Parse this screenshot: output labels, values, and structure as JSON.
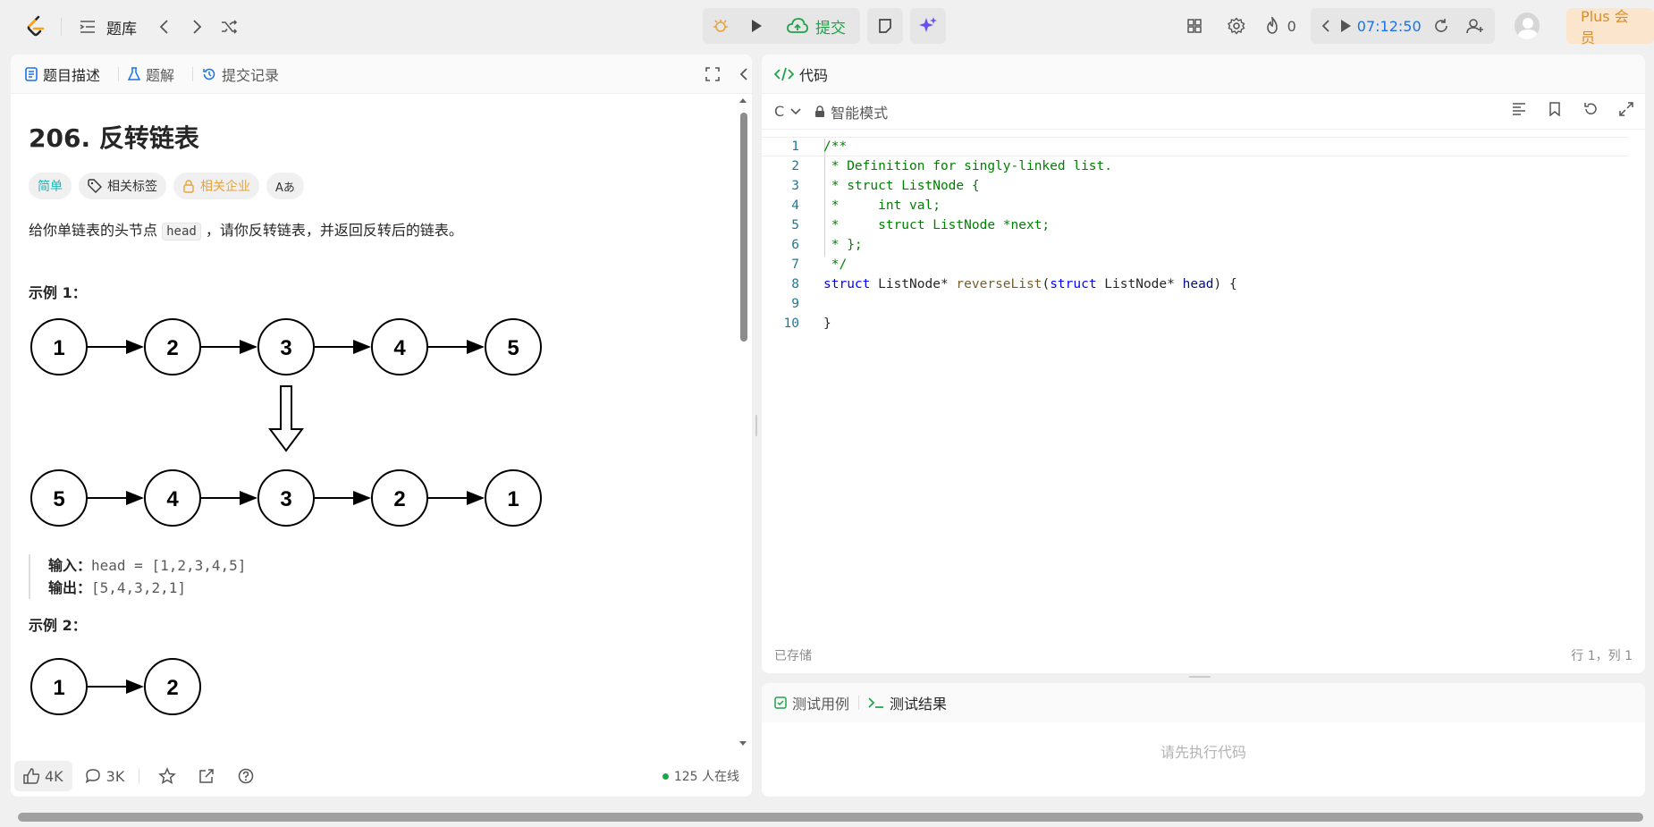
{
  "topbar": {
    "problem_list": "题库",
    "submit": "提交",
    "streak": "0",
    "timer": "07:12:50",
    "plus": "Plus 会员"
  },
  "left": {
    "tabs": [
      {
        "label": "题目描述"
      },
      {
        "label": "题解"
      },
      {
        "label": "提交记录"
      }
    ],
    "title": "206. 反转链表",
    "tags": {
      "difficulty": "简单",
      "topics": "相关标签",
      "companies": "相关企业",
      "translate": "Aあ"
    },
    "description_before": "给你单链表的头节点 ",
    "description_code": "head",
    "description_after": " ，请你反转链表，并返回反转后的链表。",
    "example1": {
      "title": "示例 1：",
      "top_nodes": [
        "1",
        "2",
        "3",
        "4",
        "5"
      ],
      "bottom_nodes": [
        "5",
        "4",
        "3",
        "2",
        "1"
      ],
      "input_label": "输入：",
      "input_value": "head = [1,2,3,4,5]",
      "output_label": "输出：",
      "output_value": "[5,4,3,2,1]"
    },
    "example2": {
      "title": "示例 2：",
      "nodes": [
        "1",
        "2"
      ]
    },
    "footer": {
      "likes": "4K",
      "comments": "3K",
      "online": "125 人在线"
    }
  },
  "code": {
    "title": "代码",
    "language": "C",
    "mode": "智能模式",
    "lines": [
      "1",
      "2",
      "3",
      "4",
      "5",
      "6",
      "7",
      "8",
      "9",
      "10"
    ],
    "text": {
      "l1": "/**",
      "l2": " * Definition for singly-linked list.",
      "l3": " * struct ListNode {",
      "l4": " *     int val;",
      "l5": " *     struct ListNode *next;",
      "l6": " * };",
      "l7": " */",
      "l8_kw1": "struct",
      "l8_t1": " ListNode* ",
      "l8_fn": "reverseList",
      "l8_p1": "(",
      "l8_kw2": "struct",
      "l8_t2": " ListNode* ",
      "l8_id": "head",
      "l8_end": ") {",
      "l10": "}"
    },
    "saved": "已存储",
    "cursor": "行 1，列 1"
  },
  "result": {
    "tab_testcase": "测试用例",
    "tab_result": "测试结果",
    "empty": "请先执行代码"
  }
}
